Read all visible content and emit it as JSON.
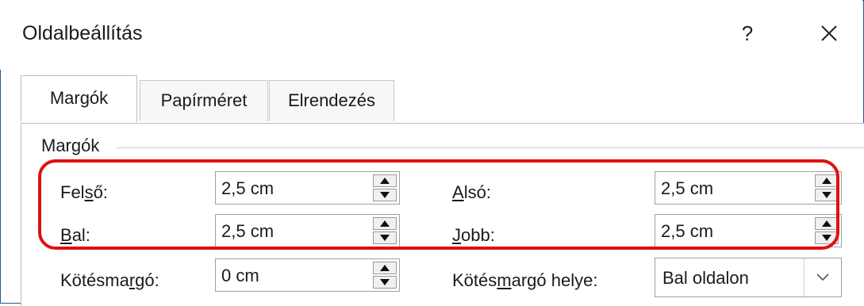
{
  "dialog": {
    "title": "Oldalbeállítás",
    "help_label": "?",
    "close_label": "close"
  },
  "tabs": [
    {
      "label": "Margók",
      "active": true
    },
    {
      "label": "Papírméret",
      "active": false
    },
    {
      "label": "Elrendezés",
      "active": false
    }
  ],
  "margins_group": {
    "label": "Margók",
    "top": {
      "label_pre": "Fel",
      "label_mnemonic": "s",
      "label_post": "ő:",
      "value": "2,5 cm"
    },
    "bottom": {
      "label_pre": "",
      "label_mnemonic": "A",
      "label_post": "lsó:",
      "value": "2,5 cm"
    },
    "left": {
      "label_pre": "",
      "label_mnemonic": "B",
      "label_post": "al:",
      "value": "2,5 cm"
    },
    "right": {
      "label_pre": "",
      "label_mnemonic": "J",
      "label_post": "obb:",
      "value": "2,5 cm"
    },
    "gutter": {
      "label_pre": "Kötésma",
      "label_mnemonic": "r",
      "label_post": "gó:",
      "value": "0 cm"
    },
    "gutter_position": {
      "label_pre": "Kötés",
      "label_mnemonic": "m",
      "label_post": "argó helye:",
      "value": "Bal oldalon"
    }
  },
  "colors": {
    "highlight": "#e01010",
    "frame": "#2b5797"
  }
}
